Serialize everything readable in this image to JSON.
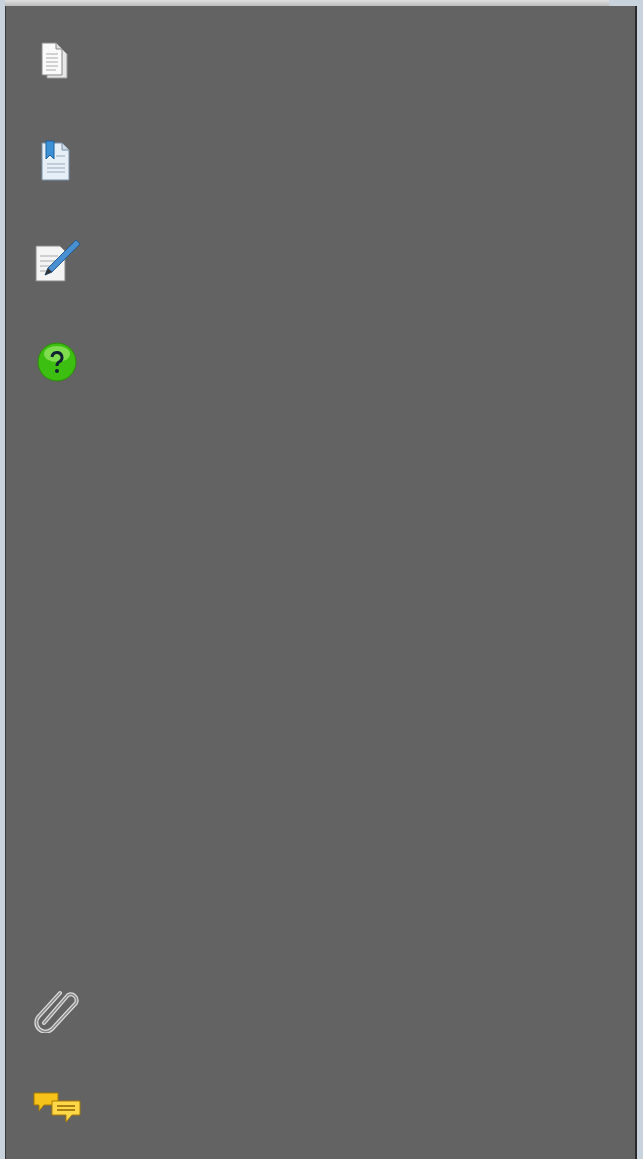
{
  "sidebar": {
    "top_items": [
      {
        "kind": "pages"
      },
      {
        "kind": "bookmarks"
      },
      {
        "kind": "signatures"
      },
      {
        "kind": "help"
      }
    ],
    "bottom_items": [
      {
        "kind": "attachments"
      },
      {
        "kind": "comments"
      }
    ]
  }
}
